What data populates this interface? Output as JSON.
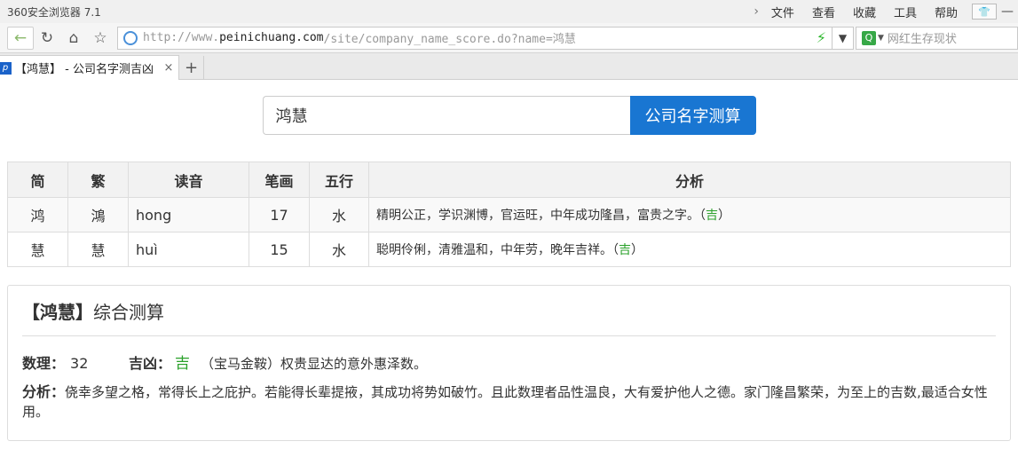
{
  "browser": {
    "app_title": "360安全浏览器 7.1",
    "menu": [
      "文件",
      "查看",
      "收藏",
      "工具",
      "帮助"
    ],
    "url_prefix": "http://www.",
    "url_host": "peinichuang.com",
    "url_path": "/site/company_name_score.do?name=鸿慧",
    "search_placeholder": "网红生存现状",
    "tab_title": "【鸿慧】 - 公司名字测吉凶",
    "icons": {
      "back": "arrow-left",
      "refresh": "refresh",
      "home": "home",
      "favorite": "star",
      "speed": "lightning",
      "dropdown": "chevron-down",
      "close": "close",
      "new_tab": "plus"
    }
  },
  "search": {
    "value": "鸿慧",
    "button_label": "公司名字测算",
    "button_color": "#1976d2"
  },
  "table": {
    "headers": [
      "简",
      "繁",
      "读音",
      "笔画",
      "五行",
      "分析"
    ],
    "rows": [
      {
        "simplified": "鸿",
        "traditional": "鴻",
        "pinyin": "hong",
        "strokes": "17",
        "element": "水",
        "analysis": "精明公正，学识渊博，官运旺，中年成功隆昌，富贵之字。（",
        "luck": "吉",
        "analysis_end": "）"
      },
      {
        "simplified": "慧",
        "traditional": "慧",
        "pinyin": "huì",
        "strokes": "15",
        "element": "水",
        "analysis": "聪明伶俐，清雅温和，中年劳，晚年吉祥。（",
        "luck": "吉",
        "analysis_end": "）"
      }
    ]
  },
  "summary": {
    "title_bracket": "【鸿慧】",
    "title_rest": "综合测算",
    "number_label": "数理：",
    "number_value": "32",
    "luck_label": "吉凶：",
    "luck_value": "吉",
    "luck_desc": "（宝马金鞍）权贵显达的意外惠泽数。",
    "analysis_label": "分析：",
    "analysis_text": "侥幸多望之格，常得长上之庇护。若能得长辈提掖，其成功将势如破竹。且此数理者品性温良，大有爱护他人之德。家门隆昌繁荣，为至上的吉数,最适合女性用。"
  },
  "colors": {
    "lucky": "#2aa12a",
    "accent": "#1976d2"
  }
}
